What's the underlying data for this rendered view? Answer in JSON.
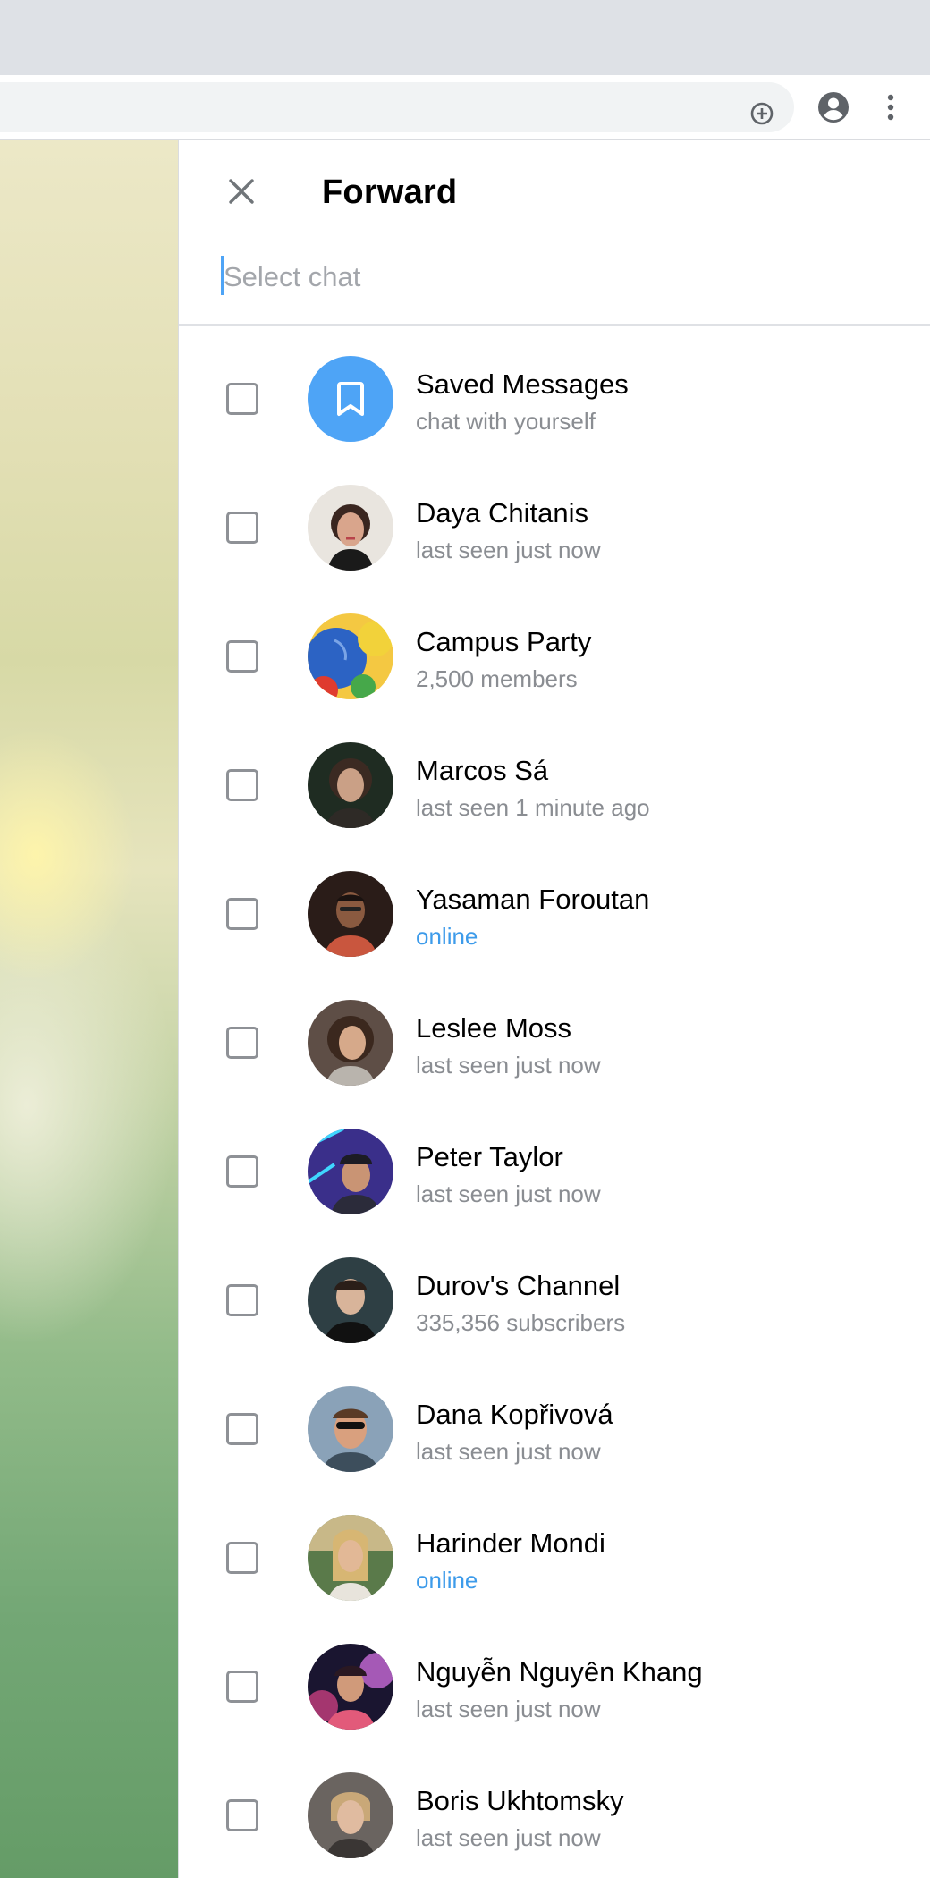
{
  "browser": {
    "add_icon": "plus-circle-icon",
    "profile_icon": "account-circle-icon",
    "menu_icon": "more-vert-icon"
  },
  "panel": {
    "title": "Forward",
    "close_icon": "close-icon",
    "search_placeholder": "Select chat",
    "accent_color": "#4ea4f6",
    "online_color": "#3d9bea"
  },
  "chats": [
    {
      "name": "Saved Messages",
      "status": "chat with yourself",
      "online": false,
      "avatar": "bookmark-icon"
    },
    {
      "name": "Daya Chitanis",
      "status": "last seen just now",
      "online": false,
      "avatar": "photo"
    },
    {
      "name": "Campus Party",
      "status": "2,500 members",
      "online": false,
      "avatar": "photo"
    },
    {
      "name": "Marcos Sá",
      "status": "last seen 1 minute ago",
      "online": false,
      "avatar": "photo"
    },
    {
      "name": "Yasaman Foroutan",
      "status": "online",
      "online": true,
      "avatar": "photo"
    },
    {
      "name": "Leslee Moss",
      "status": "last seen just now",
      "online": false,
      "avatar": "photo"
    },
    {
      "name": "Peter Taylor",
      "status": "last seen just now",
      "online": false,
      "avatar": "photo"
    },
    {
      "name": "Durov's Channel",
      "status": "335,356 subscribers",
      "online": false,
      "avatar": "photo"
    },
    {
      "name": "Dana Kopřivová",
      "status": "last seen just now",
      "online": false,
      "avatar": "photo"
    },
    {
      "name": "Harinder Mondi",
      "status": "online",
      "online": true,
      "avatar": "photo"
    },
    {
      "name": "Nguyễn Nguyên Khang",
      "status": "last seen just now",
      "online": false,
      "avatar": "photo"
    },
    {
      "name": "Boris Ukhtomsky",
      "status": "last seen just now",
      "online": false,
      "avatar": "photo"
    }
  ]
}
